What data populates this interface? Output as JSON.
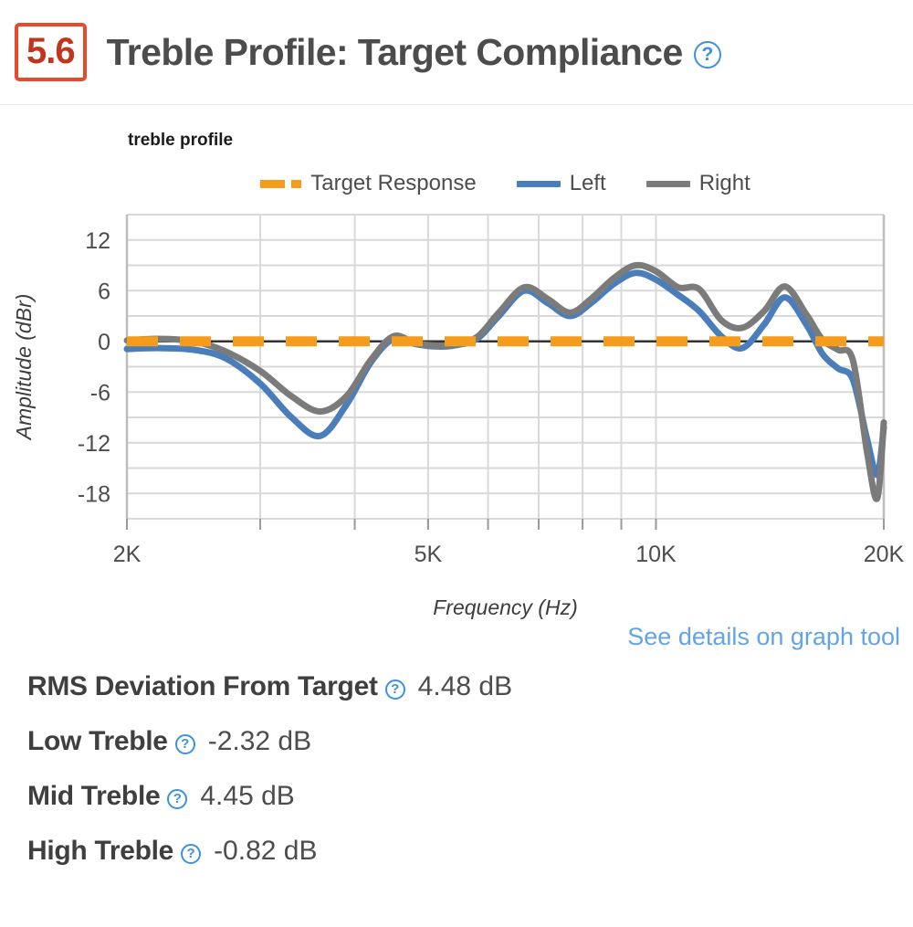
{
  "header": {
    "score": "5.6",
    "title": "Treble Profile: Target Compliance",
    "help_icon": "question-mark-circle-icon",
    "badge_border_color": "#e8492b",
    "badge_text_color": "#c1351c"
  },
  "chart_panel": {
    "detail_link": "See details on graph tool",
    "link_color": "#63a4e8"
  },
  "metrics": [
    {
      "name": "RMS Deviation From Target",
      "value": "4.48 dB"
    },
    {
      "name": "Low Treble",
      "value": "-2.32 dB"
    },
    {
      "name": "Mid Treble",
      "value": "4.45 dB"
    },
    {
      "name": "High Treble",
      "value": "-0.82 dB"
    }
  ],
  "chart_data": {
    "type": "line",
    "title": "treble profile",
    "xlabel": "Frequency (Hz)",
    "ylabel": "Amplitude (dBr)",
    "xscale": "log",
    "xlim": [
      2000,
      20000
    ],
    "ylim": [
      -21,
      15
    ],
    "xticks": [
      2000,
      5000,
      10000,
      20000
    ],
    "xtick_labels": [
      "2K",
      "5K",
      "10K",
      "20K"
    ],
    "yticks": [
      12,
      6,
      0,
      -6,
      -12,
      -18
    ],
    "ytick_labels": [
      "12",
      "6",
      "0",
      "-6",
      "-12",
      "-18"
    ],
    "minor_y_step": 3,
    "grid": true,
    "legend_position": "top-center",
    "colors": {
      "target": "#f59c1d",
      "left": "#4a7ebb",
      "right": "#7b7b7b",
      "zero_line": "#333333",
      "grid": "#d9d9d9",
      "axis": "#b3b3b3"
    },
    "series": [
      {
        "name": "Target Response",
        "color": "#f59c1d",
        "style": "dashed",
        "x": [
          2000,
          20000
        ],
        "values": [
          0,
          0
        ]
      },
      {
        "name": "Left",
        "color": "#4a7ebb",
        "style": "solid",
        "x": [
          2000,
          2200,
          2450,
          2700,
          3000,
          3300,
          3600,
          3900,
          4200,
          4500,
          4800,
          5100,
          5400,
          5800,
          6200,
          6700,
          7200,
          7700,
          8200,
          8800,
          9400,
          10000,
          10700,
          11400,
          12200,
          13000,
          13900,
          14800,
          15800,
          16600,
          17400,
          18200,
          19000,
          19600,
          20000
        ],
        "values": [
          -0.9,
          -0.8,
          -1.0,
          -2.0,
          -5.0,
          -9.0,
          -11.2,
          -7.5,
          -2.5,
          0.3,
          -0.3,
          -0.6,
          -0.5,
          0.3,
          3.0,
          6.0,
          4.5,
          3.0,
          4.5,
          6.8,
          8.1,
          7.3,
          5.5,
          3.6,
          0.6,
          -0.8,
          2.0,
          5.2,
          2.0,
          -1.5,
          -3.2,
          -4.5,
          -11.5,
          -15.8,
          -10.2
        ]
      },
      {
        "name": "Right",
        "color": "#7b7b7b",
        "style": "solid",
        "x": [
          2000,
          2200,
          2450,
          2700,
          3000,
          3300,
          3600,
          3900,
          4200,
          4500,
          4800,
          5100,
          5400,
          5800,
          6200,
          6700,
          7200,
          7700,
          8200,
          8800,
          9400,
          10000,
          10700,
          11400,
          12200,
          13000,
          13900,
          14800,
          15800,
          16600,
          17400,
          18200,
          19000,
          19600,
          20000
        ],
        "values": [
          0.1,
          0.3,
          0.0,
          -1.2,
          -3.5,
          -6.5,
          -8.3,
          -6.5,
          -2.2,
          0.6,
          -0.2,
          -0.5,
          -0.4,
          0.5,
          3.4,
          6.4,
          5.0,
          3.4,
          5.0,
          7.5,
          9.0,
          8.3,
          6.4,
          6.2,
          2.5,
          1.6,
          3.6,
          6.5,
          3.2,
          0.2,
          -1.0,
          -2.2,
          -13.0,
          -18.6,
          -9.6
        ]
      }
    ]
  }
}
